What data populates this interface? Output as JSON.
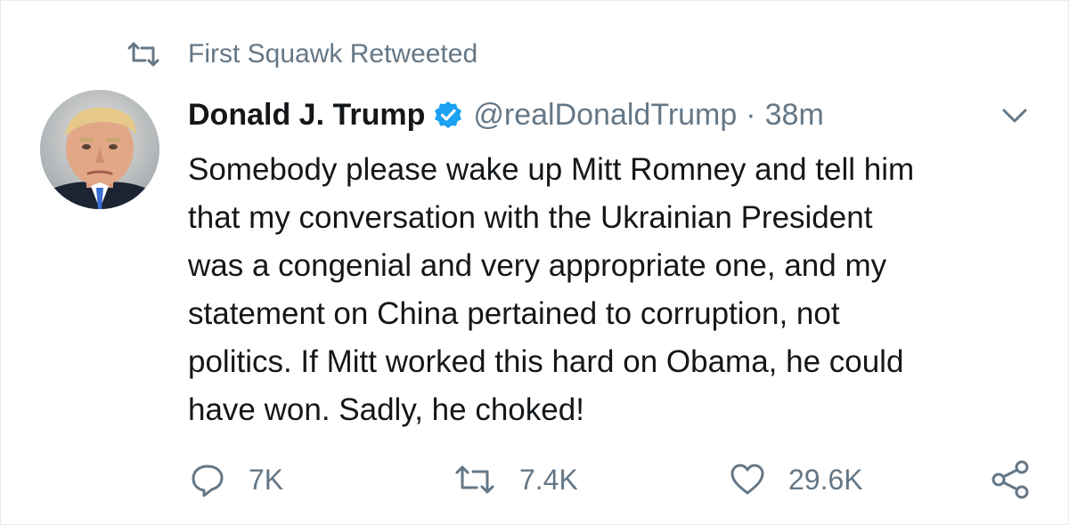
{
  "context": {
    "label": "First Squawk Retweeted",
    "icon": "retweet-icon"
  },
  "tweet": {
    "name": "Donald J. Trump",
    "handle": "@realDonaldTrump",
    "separator": "·",
    "time": "38m",
    "text": "Somebody please wake up Mitt Romney and tell him\nthat my conversation with the Ukrainian President\nwas a congenial and very appropriate one, and my\nstatement on China pertained to corruption, not\npolitics. If Mitt worked this hard on Obama, he could\nhave won. Sadly, he choked!",
    "verified_icon": "verified-badge-icon",
    "menu_icon": "chevron-down-icon"
  },
  "actions": {
    "reply": {
      "icon": "reply-icon",
      "count": "7K"
    },
    "retweet": {
      "icon": "retweet-icon",
      "count": "7.4K"
    },
    "like": {
      "icon": "heart-icon",
      "count": "29.6K"
    },
    "share": {
      "icon": "share-icon"
    }
  },
  "colors": {
    "text_primary": "#14171a",
    "text_secondary": "#657786",
    "verified_blue": "#1da1f2",
    "border": "#e6ecf0"
  }
}
